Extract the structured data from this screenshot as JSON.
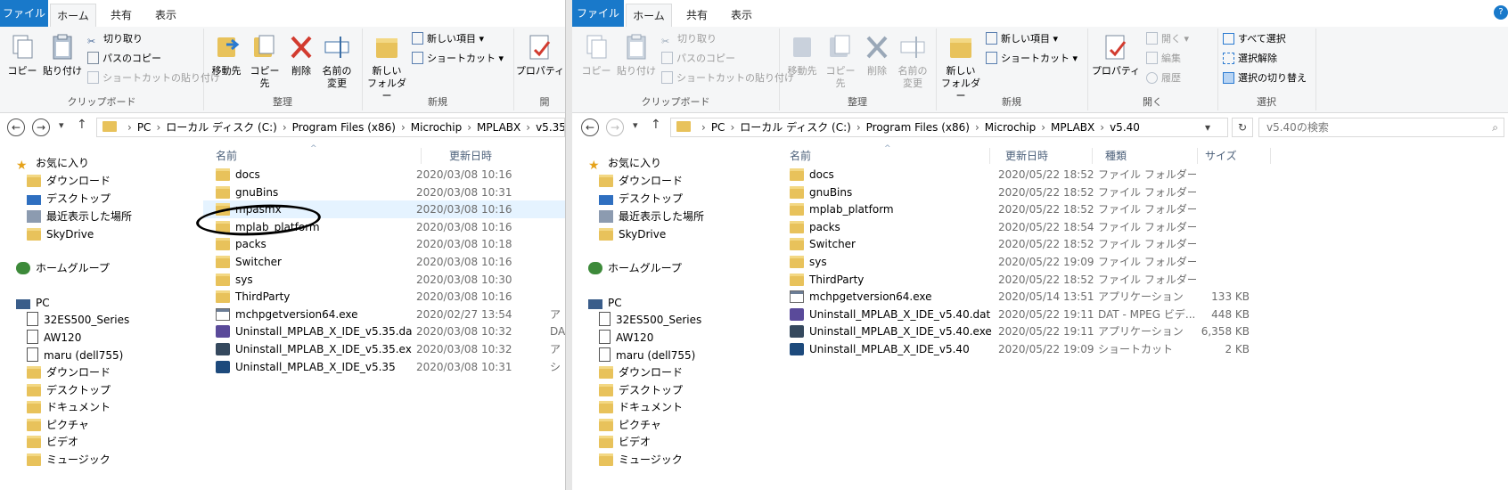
{
  "left": {
    "tabs": [
      "ファイル",
      "ホーム",
      "共有",
      "表示"
    ],
    "ribbon": {
      "clipboard": {
        "label": "クリップボード",
        "copy": "コピー",
        "paste": "貼り付け",
        "cut": "切り取り",
        "copy_path": "パスのコピー",
        "paste_shortcut": "ショートカットの貼り付け"
      },
      "organize": {
        "label": "整理",
        "move_to": "移動先",
        "copy_to": "コピー先",
        "delete": "削除",
        "rename_line1": "名前の",
        "rename_line2": "変更"
      },
      "new": {
        "label": "新規",
        "new_folder_line1": "新しい",
        "new_folder_line2": "フォルダー",
        "new_item": "新しい項目",
        "shortcut": "ショートカット"
      },
      "open": {
        "label": "開",
        "properties": "プロパティ"
      }
    },
    "breadcrumb": [
      "PC",
      "ローカル ディスク (C:)",
      "Program Files (x86)",
      "Microchip",
      "MPLABX",
      "v5.35"
    ],
    "columns": {
      "name": "名前",
      "modified": "更新日時"
    },
    "files": [
      {
        "name": "docs",
        "date": "2020/03/08 10:16",
        "type": "",
        "kind": "folder"
      },
      {
        "name": "gnuBins",
        "date": "2020/03/08 10:31",
        "type": "",
        "kind": "folder"
      },
      {
        "name": "mpasmx",
        "date": "2020/03/08 10:16",
        "type": "",
        "kind": "folder"
      },
      {
        "name": "mplab_platform",
        "date": "2020/03/08 10:16",
        "type": "",
        "kind": "folder"
      },
      {
        "name": "packs",
        "date": "2020/03/08 10:18",
        "type": "",
        "kind": "folder"
      },
      {
        "name": "Switcher",
        "date": "2020/03/08 10:16",
        "type": "",
        "kind": "folder"
      },
      {
        "name": "sys",
        "date": "2020/03/08 10:30",
        "type": "",
        "kind": "folder"
      },
      {
        "name": "ThirdParty",
        "date": "2020/03/08 10:16",
        "type": "",
        "kind": "folder"
      },
      {
        "name": "mchpgetversion64.exe",
        "date": "2020/02/27 13:54",
        "type": "ア",
        "kind": "exe"
      },
      {
        "name": "Uninstall_MPLAB_X_IDE_v5.35.dat",
        "date": "2020/03/08 10:32",
        "type": "DA",
        "kind": "dat"
      },
      {
        "name": "Uninstall_MPLAB_X_IDE_v5.35.exe",
        "date": "2020/03/08 10:32",
        "type": "ア",
        "kind": "unexe"
      },
      {
        "name": "Uninstall_MPLAB_X_IDE_v5.35",
        "date": "2020/03/08 10:31",
        "type": "シ",
        "kind": "lnk"
      }
    ]
  },
  "right": {
    "tabs": [
      "ファイル",
      "ホーム",
      "共有",
      "表示"
    ],
    "ribbon": {
      "clipboard": {
        "label": "クリップボード",
        "copy": "コピー",
        "paste": "貼り付け",
        "cut": "切り取り",
        "copy_path": "パスのコピー",
        "paste_shortcut": "ショートカットの貼り付け"
      },
      "organize": {
        "label": "整理",
        "move_to": "移動先",
        "copy_to": "コピー先",
        "delete": "削除",
        "rename_line1": "名前の",
        "rename_line2": "変更"
      },
      "new": {
        "label": "新規",
        "new_folder_line1": "新しい",
        "new_folder_line2": "フォルダー",
        "new_item": "新しい項目",
        "shortcut": "ショートカット"
      },
      "open": {
        "label": "開く",
        "properties": "プロパティ",
        "open": "開く",
        "edit": "編集",
        "history": "履歴"
      },
      "select": {
        "label": "選択",
        "select_all": "すべて選択",
        "select_none": "選択解除",
        "invert": "選択の切り替え"
      }
    },
    "breadcrumb": [
      "PC",
      "ローカル ディスク (C:)",
      "Program Files (x86)",
      "Microchip",
      "MPLABX",
      "v5.40"
    ],
    "search_placeholder": "v5.40の検索",
    "columns": {
      "name": "名前",
      "modified": "更新日時",
      "type": "種類",
      "size": "サイズ"
    },
    "files": [
      {
        "name": "docs",
        "date": "2020/05/22 18:52",
        "type": "ファイル フォルダー",
        "size": "",
        "kind": "folder"
      },
      {
        "name": "gnuBins",
        "date": "2020/05/22 18:52",
        "type": "ファイル フォルダー",
        "size": "",
        "kind": "folder"
      },
      {
        "name": "mplab_platform",
        "date": "2020/05/22 18:52",
        "type": "ファイル フォルダー",
        "size": "",
        "kind": "folder"
      },
      {
        "name": "packs",
        "date": "2020/05/22 18:54",
        "type": "ファイル フォルダー",
        "size": "",
        "kind": "folder"
      },
      {
        "name": "Switcher",
        "date": "2020/05/22 18:52",
        "type": "ファイル フォルダー",
        "size": "",
        "kind": "folder"
      },
      {
        "name": "sys",
        "date": "2020/05/22 19:09",
        "type": "ファイル フォルダー",
        "size": "",
        "kind": "folder"
      },
      {
        "name": "ThirdParty",
        "date": "2020/05/22 18:52",
        "type": "ファイル フォルダー",
        "size": "",
        "kind": "folder"
      },
      {
        "name": "mchpgetversion64.exe",
        "date": "2020/05/14 13:51",
        "type": "アプリケーション",
        "size": "133 KB",
        "kind": "exe"
      },
      {
        "name": "Uninstall_MPLAB_X_IDE_v5.40.dat",
        "date": "2020/05/22 19:11",
        "type": "DAT - MPEG ビデ...",
        "size": "448 KB",
        "kind": "dat"
      },
      {
        "name": "Uninstall_MPLAB_X_IDE_v5.40.exe",
        "date": "2020/05/22 19:11",
        "type": "アプリケーション",
        "size": "6,358 KB",
        "kind": "unexe"
      },
      {
        "name": "Uninstall_MPLAB_X_IDE_v5.40",
        "date": "2020/05/22 19:09",
        "type": "ショートカット",
        "size": "2 KB",
        "kind": "lnk"
      }
    ]
  },
  "navpane": {
    "favorites": "お気に入り",
    "downloads": "ダウンロード",
    "desktop": "デスクトップ",
    "recent": "最近表示した場所",
    "skydrive": "SkyDrive",
    "homegroup": "ホームグループ",
    "pc": "PC",
    "dev1": "32ES500_Series",
    "dev2": "AW120",
    "dev3": "maru (dell755)",
    "pc_downloads": "ダウンロード",
    "pc_desktop": "デスクトップ",
    "documents": "ドキュメント",
    "pictures": "ピクチャ",
    "videos": "ビデオ",
    "music": "ミュージック"
  }
}
